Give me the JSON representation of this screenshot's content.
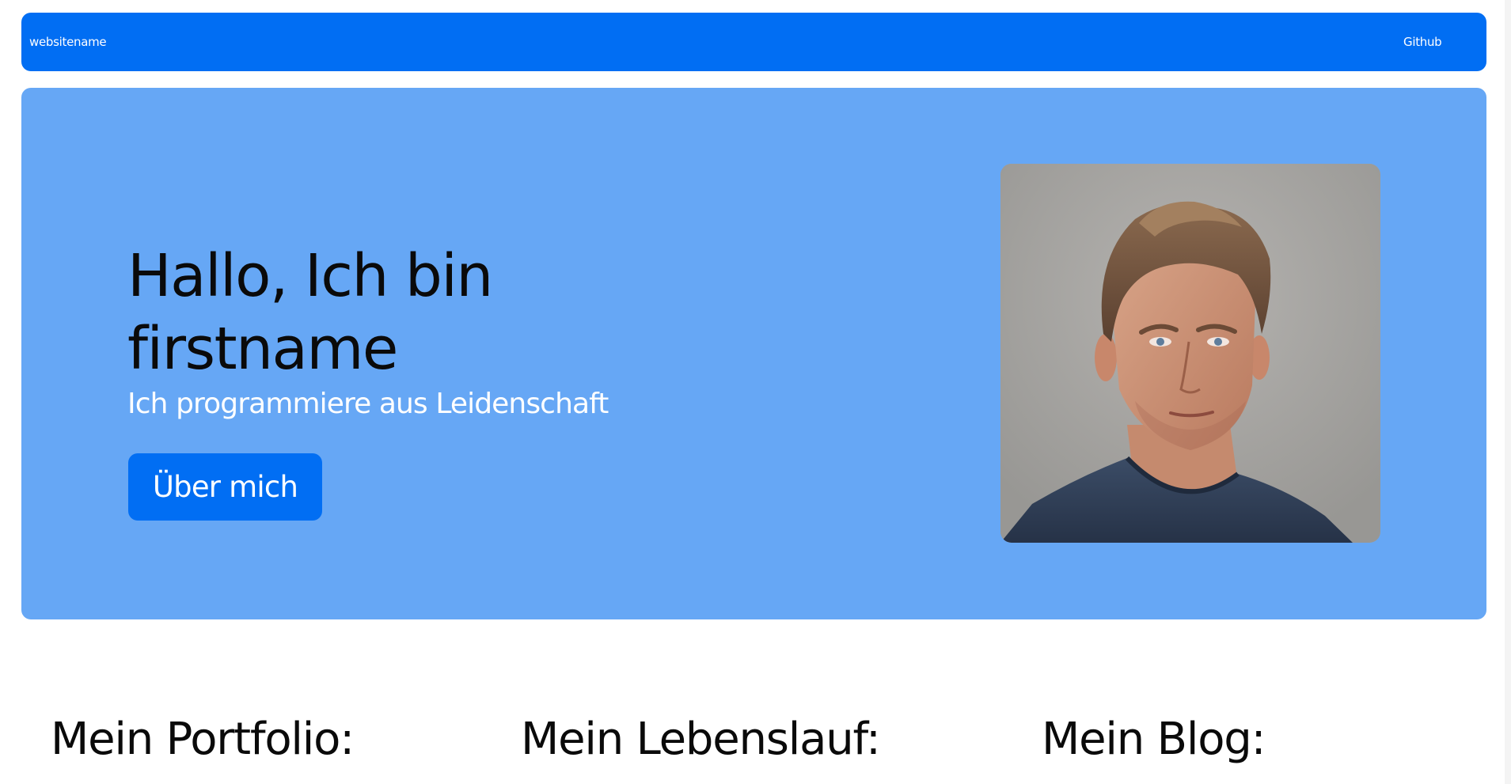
{
  "navbar": {
    "brand": "websitename",
    "link_github": "Github"
  },
  "hero": {
    "title": "Hallo, Ich bin firstname",
    "subtitle": "Ich programmiere aus Leidenschaft",
    "button_label": "Über mich",
    "portrait_alt": "Portrait",
    "background_color": "#66a7f5"
  },
  "sections": {
    "portfolio_heading": "Mein Portfolio:",
    "lebenslauf_heading": "Mein Lebenslauf:",
    "blog_heading": "Mein Blog:"
  },
  "colors": {
    "accent": "#016ef3",
    "text": "#0a0a0a"
  }
}
